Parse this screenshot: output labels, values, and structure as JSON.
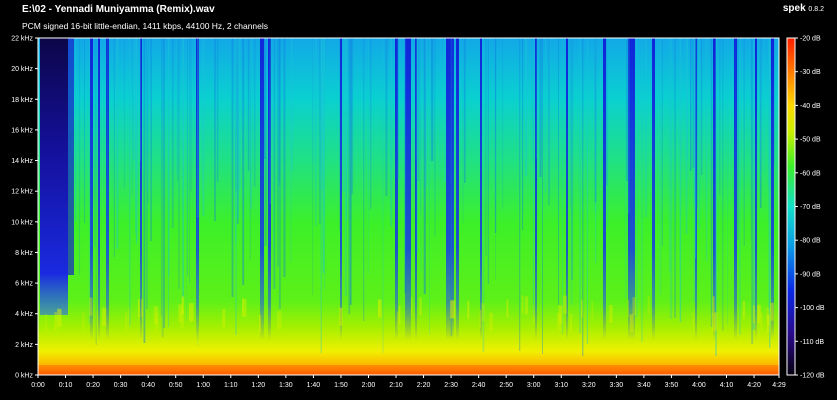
{
  "window": {
    "title": "E:\\02 - Yennadi Muniyamma (Remix).wav",
    "subtitle": "PCM signed 16-bit little-endian, 1411 kbps, 44100 Hz, 2 channels",
    "app_name": "spek",
    "app_version": "0.8.2"
  },
  "colors": {
    "background": "#000000",
    "text": "#ffffff",
    "gradient": [
      "#06000f",
      "#2a0a8a",
      "#0a28e6",
      "#0a9ae6",
      "#12e0c8",
      "#3cf028",
      "#c8f000",
      "#ffd800",
      "#ff7a00",
      "#ff1e00"
    ]
  },
  "spectrogram": {
    "freq_axis_labels": [
      "0 kHz",
      "2 kHz",
      "4 kHz",
      "6 kHz",
      "8 kHz",
      "10 kHz",
      "12 kHz",
      "14 kHz",
      "16 kHz",
      "18 kHz",
      "20 kHz",
      "22 kHz"
    ],
    "time_axis_labels": [
      "0:00",
      "0:10",
      "0:20",
      "0:30",
      "0:40",
      "0:50",
      "1:00",
      "1:10",
      "1:20",
      "1:30",
      "1:40",
      "1:50",
      "2:00",
      "2:10",
      "2:20",
      "2:30",
      "2:40",
      "2:50",
      "3:00",
      "3:10",
      "3:20",
      "3:30",
      "3:40",
      "3:50",
      "4:00",
      "4:10",
      "4:20",
      "4:29"
    ],
    "db_scale_labels": [
      "-20 dB",
      "-30 dB",
      "-40 dB",
      "-50 dB",
      "-60 dB",
      "-70 dB",
      "-80 dB",
      "-90 dB",
      "-100 dB",
      "-110 dB",
      "-120 dB"
    ]
  }
}
